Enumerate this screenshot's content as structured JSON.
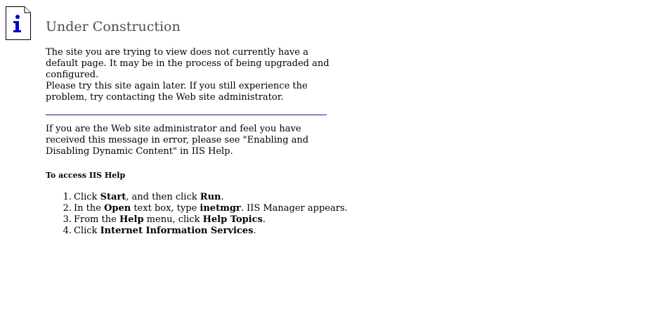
{
  "page": {
    "title": "Under Construction",
    "paragraph1": "The site you are trying to view does not currently have a default page. It may be in the process of being upgraded and configured.",
    "paragraph2": "Please try this site again later. If you still experience the problem, try contacting the Web site administrator.",
    "paragraph3": "If you are the Web site administrator and feel you have received this message in error, please see \"Enabling and Disabling Dynamic Content\" in IIS Help.",
    "help_heading": "To access IIS Help"
  },
  "steps": [
    {
      "number": "1.",
      "t1": "Click ",
      "b1": "Start",
      "t2": ", and then click ",
      "b2": "Run",
      "t3": "."
    },
    {
      "number": "2.",
      "t1": "In the ",
      "b1": "Open",
      "t2": " text box, type ",
      "b2": "inetmgr",
      "t3": ". IIS Manager appears."
    },
    {
      "number": "3.",
      "t1": "From the ",
      "b1": "Help",
      "t2": " menu, click ",
      "b2": "Help Topics",
      "t3": "."
    },
    {
      "number": "4.",
      "t1": "Click ",
      "b1": "Internet Information Services",
      "t2": "",
      "b2": "",
      "t3": "."
    }
  ],
  "colors": {
    "title": "#4d4d4d",
    "divider": "#1a1a9a",
    "icon_glyph": "#0000cc"
  },
  "icons": {
    "info": "info-page-icon"
  }
}
